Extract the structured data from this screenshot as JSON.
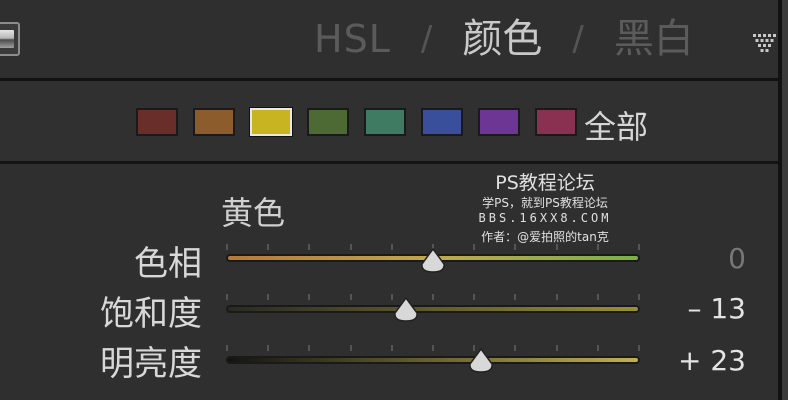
{
  "header": {
    "tabs": [
      {
        "label": "HSL",
        "active": false
      },
      {
        "label": "颜色",
        "active": true
      },
      {
        "label": "黑白",
        "active": false
      }
    ],
    "separator": "/"
  },
  "color_swatches": {
    "items": [
      {
        "name": "red",
        "color": "#6a2e2a",
        "selected": false
      },
      {
        "name": "orange",
        "color": "#8c5c2c",
        "selected": false
      },
      {
        "name": "yellow",
        "color": "#c7b420",
        "selected": true
      },
      {
        "name": "green",
        "color": "#4e6a34",
        "selected": false
      },
      {
        "name": "aqua",
        "color": "#3f7a62",
        "selected": false
      },
      {
        "name": "blue",
        "color": "#3a4f9c",
        "selected": false
      },
      {
        "name": "purple",
        "color": "#6d3594",
        "selected": false
      },
      {
        "name": "magenta",
        "color": "#8a3050",
        "selected": false
      }
    ],
    "all_label": "全部"
  },
  "section": {
    "title": "黄色"
  },
  "sliders": [
    {
      "label": "色相",
      "value": "0",
      "level": 0.5,
      "track": "linear-gradient(90deg,#b47a3a,#c0a850 50%,#7cb048)"
    },
    {
      "label": "饱和度",
      "value": "– 13",
      "level": 0.435,
      "track": "linear-gradient(90deg,#2a2a22,#9a9030)"
    },
    {
      "label": "明亮度",
      "value": "+ 23",
      "level": 0.615,
      "track": "linear-gradient(90deg,#141410,#c0b050)"
    }
  ],
  "watermark": {
    "title": "PS教程论坛",
    "line2": "学PS，就到PS教程论坛",
    "line3": "BBS.16XX8.COM",
    "line4": "作者：@爱拍照的tan克"
  }
}
